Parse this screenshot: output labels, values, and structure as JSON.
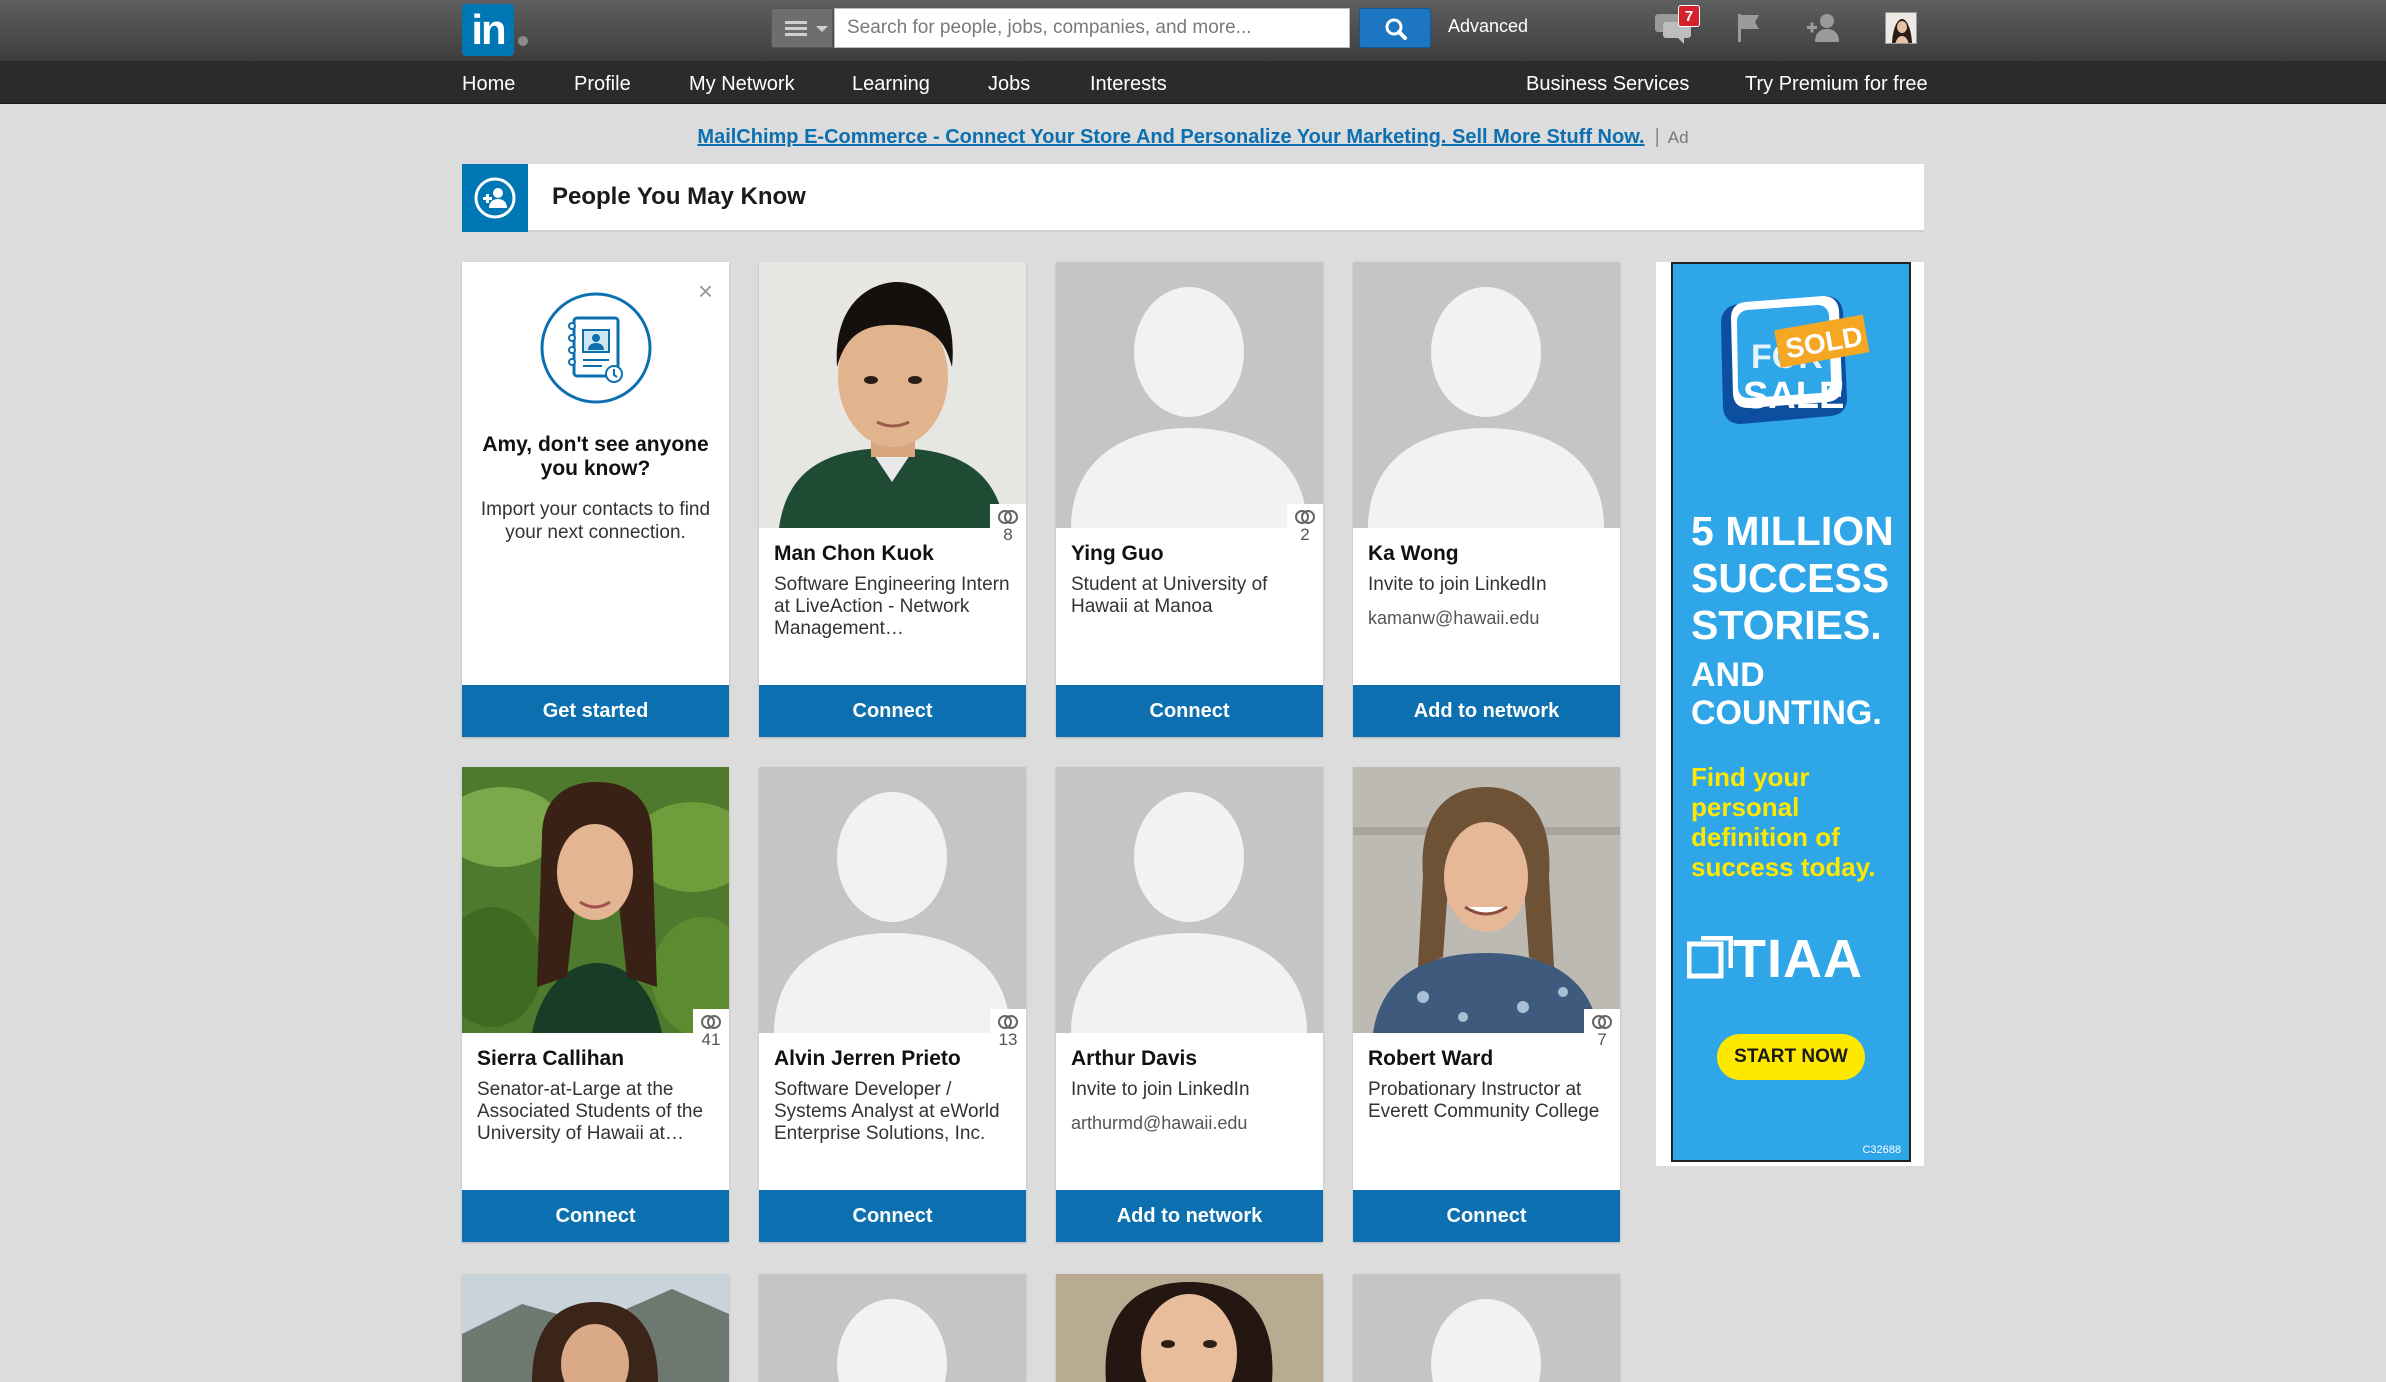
{
  "header": {
    "logo": "in",
    "search_placeholder": "Search for people, jobs, companies, and more...",
    "advanced_label": "Advanced",
    "notification_count": "7"
  },
  "nav": {
    "left": [
      "Home",
      "Profile",
      "My Network",
      "Learning",
      "Jobs",
      "Interests"
    ],
    "right": [
      "Business Services",
      "Try Premium for free"
    ]
  },
  "ad_banner": {
    "link": "MailChimp E-Commerce - Connect Your Store And Personalize Your Marketing. Sell More Stuff Now.",
    "separator": "|",
    "tag": "Ad"
  },
  "section": {
    "title": "People You May Know"
  },
  "import_card": {
    "title": "Amy, don't see anyone you know?",
    "text": "Import your contacts to find your next connection.",
    "button": "Get started",
    "close": "×"
  },
  "people": [
    {
      "name": "Man Chon Kuok",
      "headline": "Software Engineering Intern at LiveAction - Network Management…",
      "shared": "8",
      "button": "Connect",
      "photo": "young-man-photo"
    },
    {
      "name": "Ying Guo",
      "headline": "Student at University of Hawaii at Manoa",
      "shared": "2",
      "button": "Connect",
      "photo": "placeholder"
    },
    {
      "name": "Ka Wong",
      "headline": "Invite to join LinkedIn",
      "email": "kamanw@hawaii.edu",
      "button": "Add to network",
      "photo": "placeholder"
    },
    {
      "name": "Sierra Callihan",
      "headline": "Senator-at-Large at the Associated Students of the University of Hawaii at…",
      "shared": "41",
      "button": "Connect",
      "photo": "woman-plants-photo"
    },
    {
      "name": "Alvin Jerren Prieto",
      "headline": "Software Developer / Systems Analyst at eWorld Enterprise Solutions, Inc.",
      "shared": "13",
      "button": "Connect",
      "photo": "placeholder"
    },
    {
      "name": "Arthur Davis",
      "headline": "Invite to join LinkedIn",
      "email": "arthurmd@hawaii.edu",
      "button": "Add to network",
      "photo": "placeholder"
    },
    {
      "name": "Robert Ward",
      "headline": "Probationary Instructor at Everett Community College",
      "shared": "7",
      "button": "Connect",
      "photo": "man-longhair-photo"
    }
  ],
  "side_ad": {
    "sold": "SOLD",
    "for_sale": "FOR SALE",
    "line1": "5 MILLION",
    "line2": "SUCCESS",
    "line3": "STORIES.",
    "line4": "AND",
    "line5": "COUNTING.",
    "sub1": "Find your",
    "sub2": "personal",
    "sub3": "definition of",
    "sub4": "success today.",
    "brand": "TIAA",
    "cta": "START NOW",
    "code": "C32688"
  },
  "colors": {
    "brand": "#0077b5",
    "button": "#0b6fb0",
    "ad_bg": "#2ea6e8",
    "ad_yellow": "#ffe800"
  }
}
